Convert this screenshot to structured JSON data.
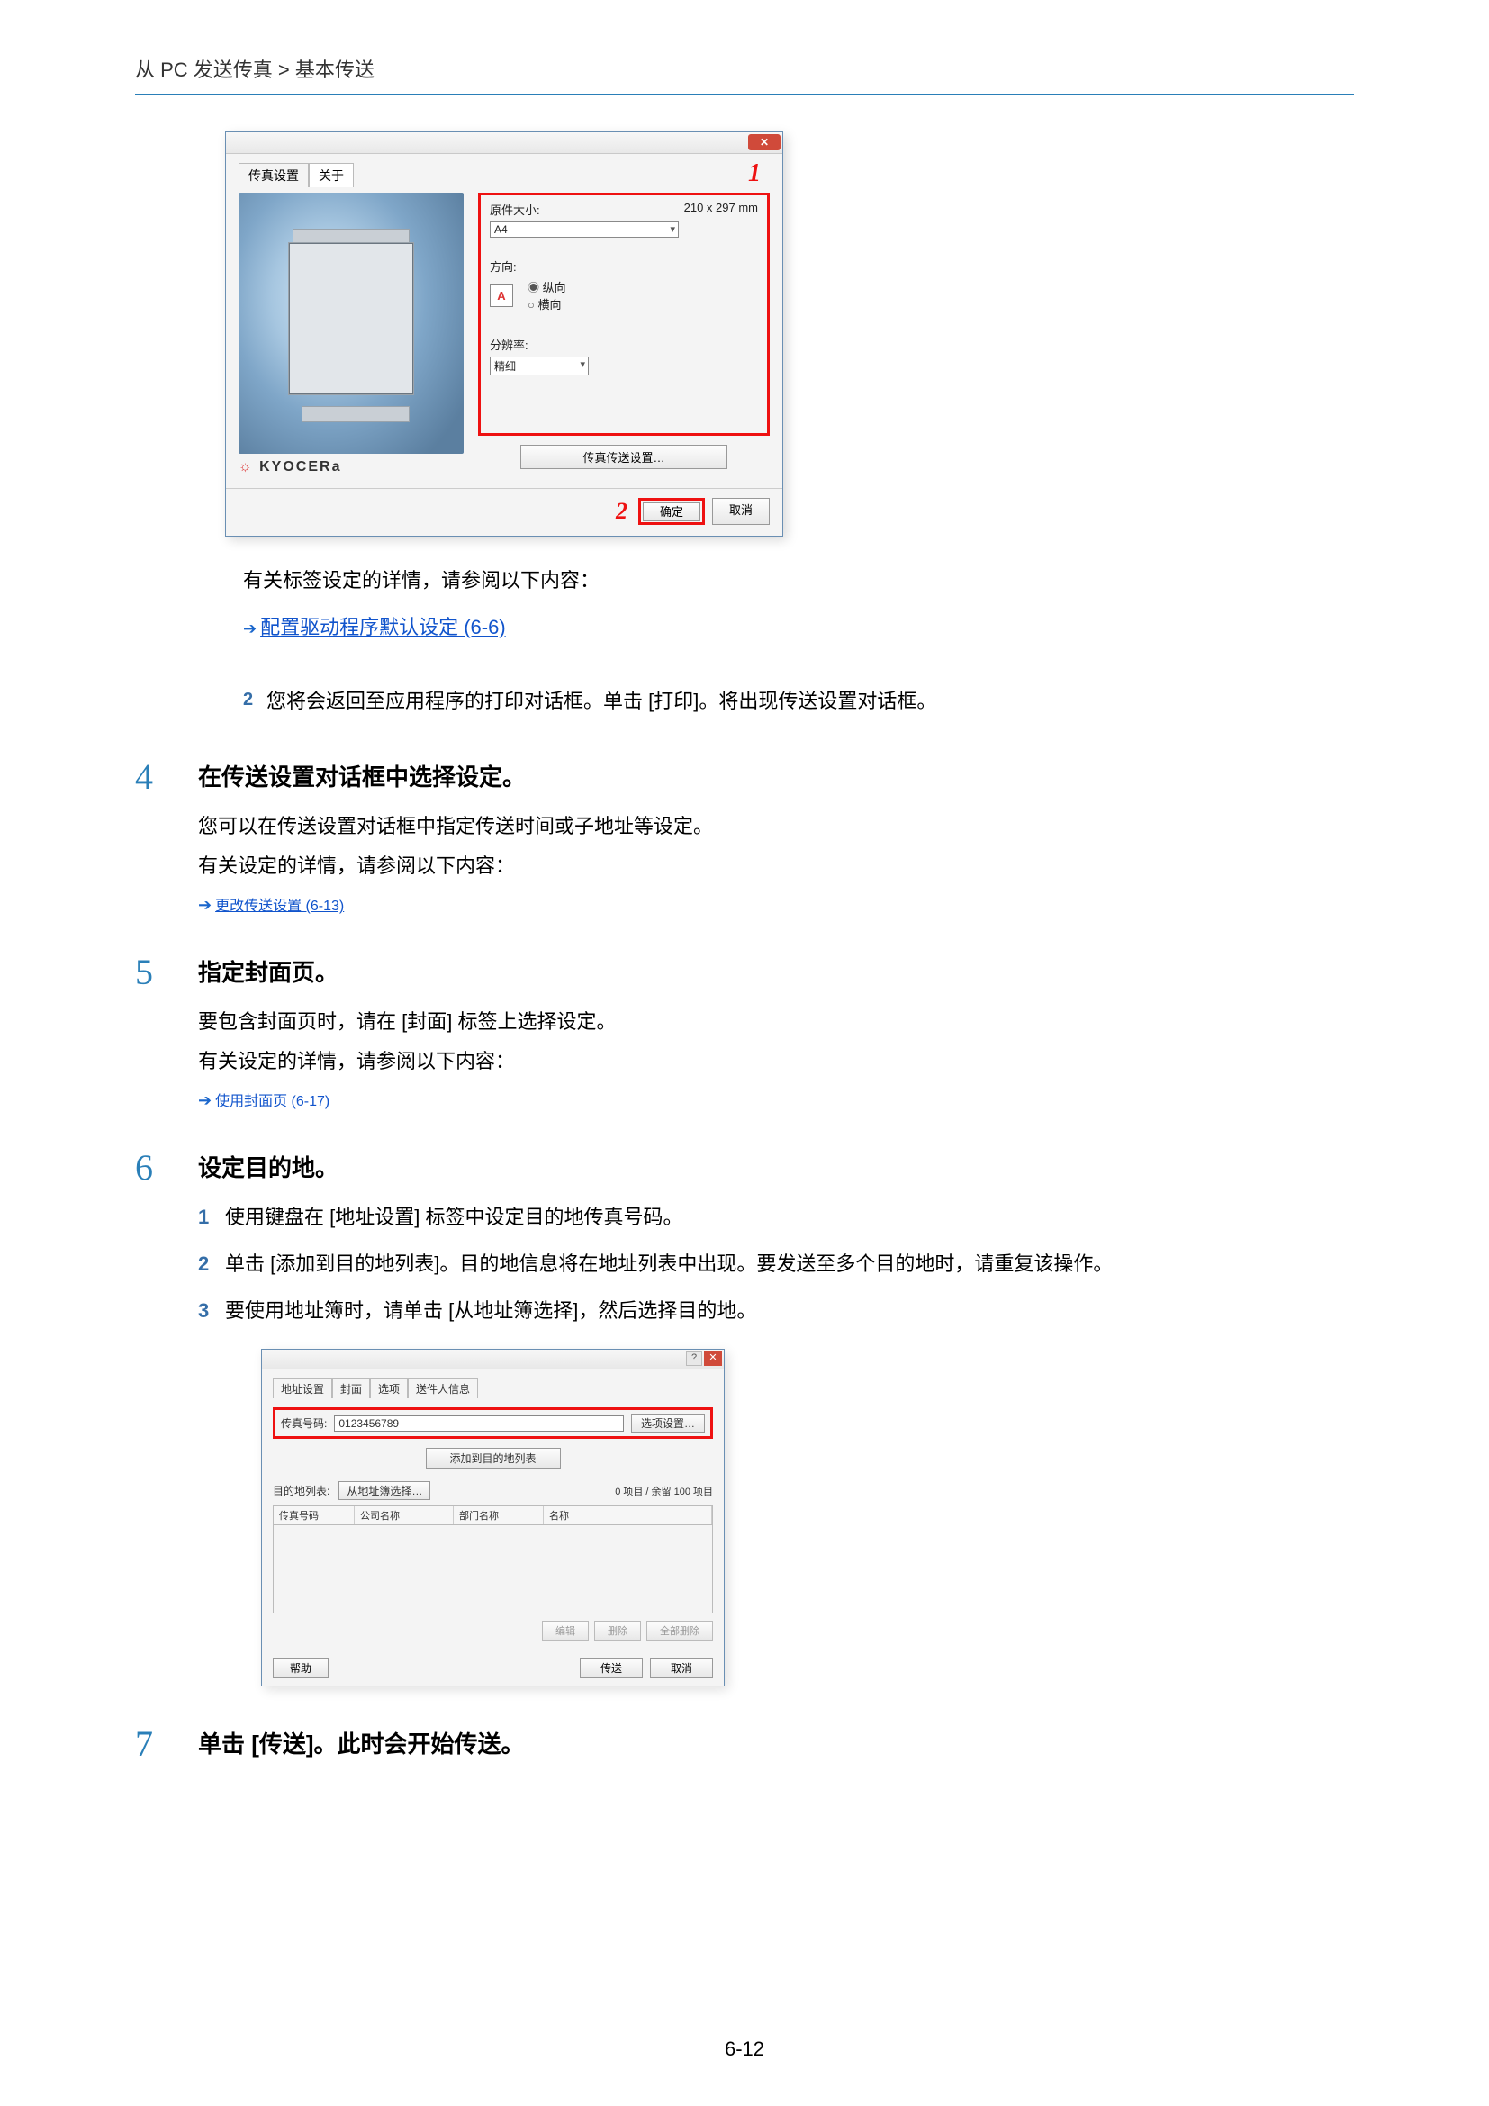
{
  "breadcrumb": "从 PC 发送传真 > 基本传送",
  "dialog1": {
    "tabs": {
      "settings": "传真设置",
      "about": "关于"
    },
    "origSizeLabel": "原件大小:",
    "origSizeValue": "210 x 297 mm",
    "sizeSelect": "A4",
    "orientLabel": "方向:",
    "orientA": "A",
    "orientPortrait": "纵向",
    "orientLandscape": "横向",
    "resLabel": "分辨率:",
    "resSelect": "精细",
    "faxBtn": "传真传送设置…",
    "ok": "确定",
    "cancel": "取消",
    "brand": "KYOCERa",
    "call1": "1",
    "call2": "2"
  },
  "aftershot": {
    "l1": "有关标签设定的详情，请参阅以下内容：",
    "link1": "配置驱动程序默认设定 (6-6)",
    "sub2": "您将会返回至应用程序的打印对话框。单击 [打印]。将出现传送设置对话框。"
  },
  "step4": {
    "num": "4",
    "title": "在传送设置对话框中选择设定。",
    "p1": "您可以在传送设置对话框中指定传送时间或子地址等设定。",
    "p2": "有关设定的详情，请参阅以下内容：",
    "link": "更改传送设置 (6-13)"
  },
  "step5": {
    "num": "5",
    "title": "指定封面页。",
    "p1": "要包含封面页时，请在 [封面] 标签上选择设定。",
    "p2": "有关设定的详情，请参阅以下内容：",
    "link": "使用封面页 (6-17)"
  },
  "step6": {
    "num": "6",
    "title": "设定目的地。",
    "s1": "使用键盘在 [地址设置] 标签中设定目的地传真号码。",
    "s2": "单击 [添加到目的地列表]。目的地信息将在地址列表中出现。要发送至多个目的地时，请重复该操作。",
    "s3": "要使用地址簿时，请单击 [从地址簿选择]，然后选择目的地。"
  },
  "dialog2": {
    "tabs": {
      "t1": "地址设置",
      "t2": "封面",
      "t3": "选项",
      "t4": "送件人信息"
    },
    "faxNoLabel": "传真号码:",
    "faxNoValue": "0123456789",
    "optBtn": "选项设置…",
    "addBtn": "添加到目的地列表",
    "destListLabel": "目的地列表:",
    "fromAddrBtn": "从地址簿选择…",
    "countText": "0 项目 / 余留 100 项目",
    "th1": "传真号码",
    "th2": "公司名称",
    "th3": "部门名称",
    "th4": "名称",
    "edit": "编辑",
    "del": "删除",
    "delAll": "全部删除",
    "help": "帮助",
    "send": "传送",
    "cancel": "取消"
  },
  "step7": {
    "num": "7",
    "title": "单击 [传送]。此时会开始传送。"
  },
  "pageNum": "6-12"
}
